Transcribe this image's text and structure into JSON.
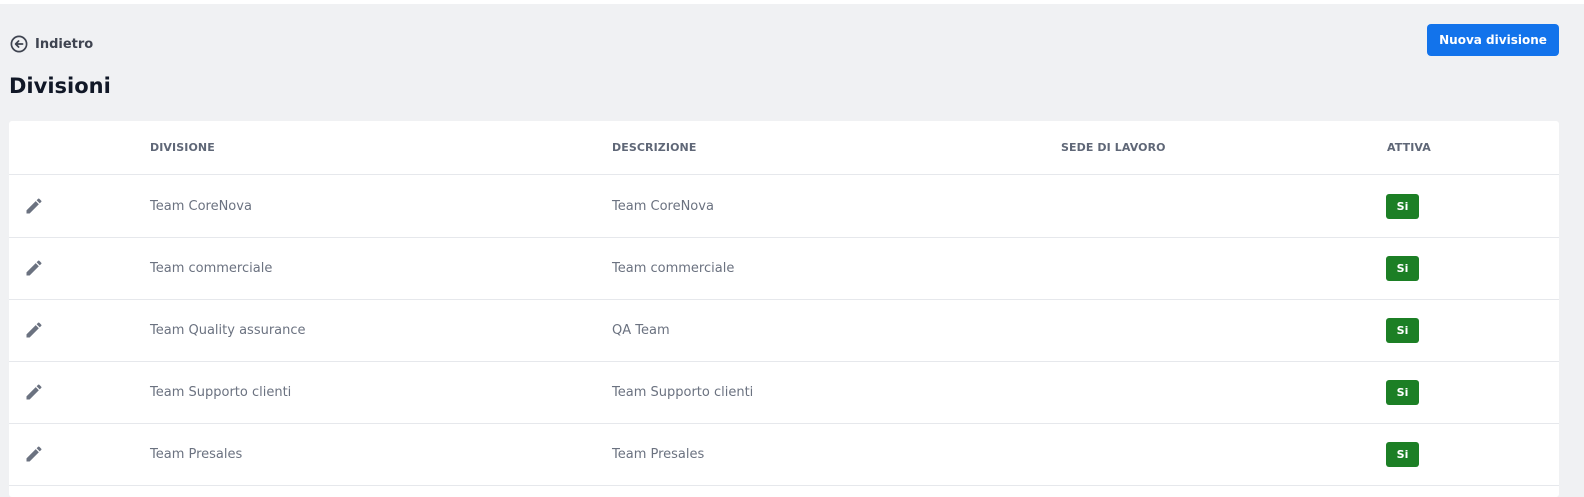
{
  "header": {
    "back_label": "Indietro",
    "new_button_label": "Nuova divisione",
    "page_title": "Divisioni"
  },
  "table": {
    "columns": [
      "DIVISIONE",
      "DESCRIZIONE",
      "SEDE DI LAVORO",
      "ATTIVA"
    ],
    "rows": [
      {
        "divisione": "Team CoreNova",
        "descrizione": "Team CoreNova",
        "sede": "",
        "attiva": "Si"
      },
      {
        "divisione": "Team commerciale",
        "descrizione": "Team commerciale",
        "sede": "",
        "attiva": "Si"
      },
      {
        "divisione": "Team Quality assurance",
        "descrizione": "QA Team",
        "sede": "",
        "attiva": "Si"
      },
      {
        "divisione": "Team Supporto clienti",
        "descrizione": "Team Supporto clienti",
        "sede": "",
        "attiva": "Si"
      },
      {
        "divisione": "Team Presales",
        "descrizione": "Team Presales",
        "sede": "",
        "attiva": "Si"
      }
    ]
  },
  "icons": {
    "back": "arrow-left-circle-icon",
    "edit": "pencil-icon"
  },
  "colors": {
    "accent": "#1273eb",
    "active_badge": "#1c7f25",
    "background": "#f0f1f3"
  }
}
